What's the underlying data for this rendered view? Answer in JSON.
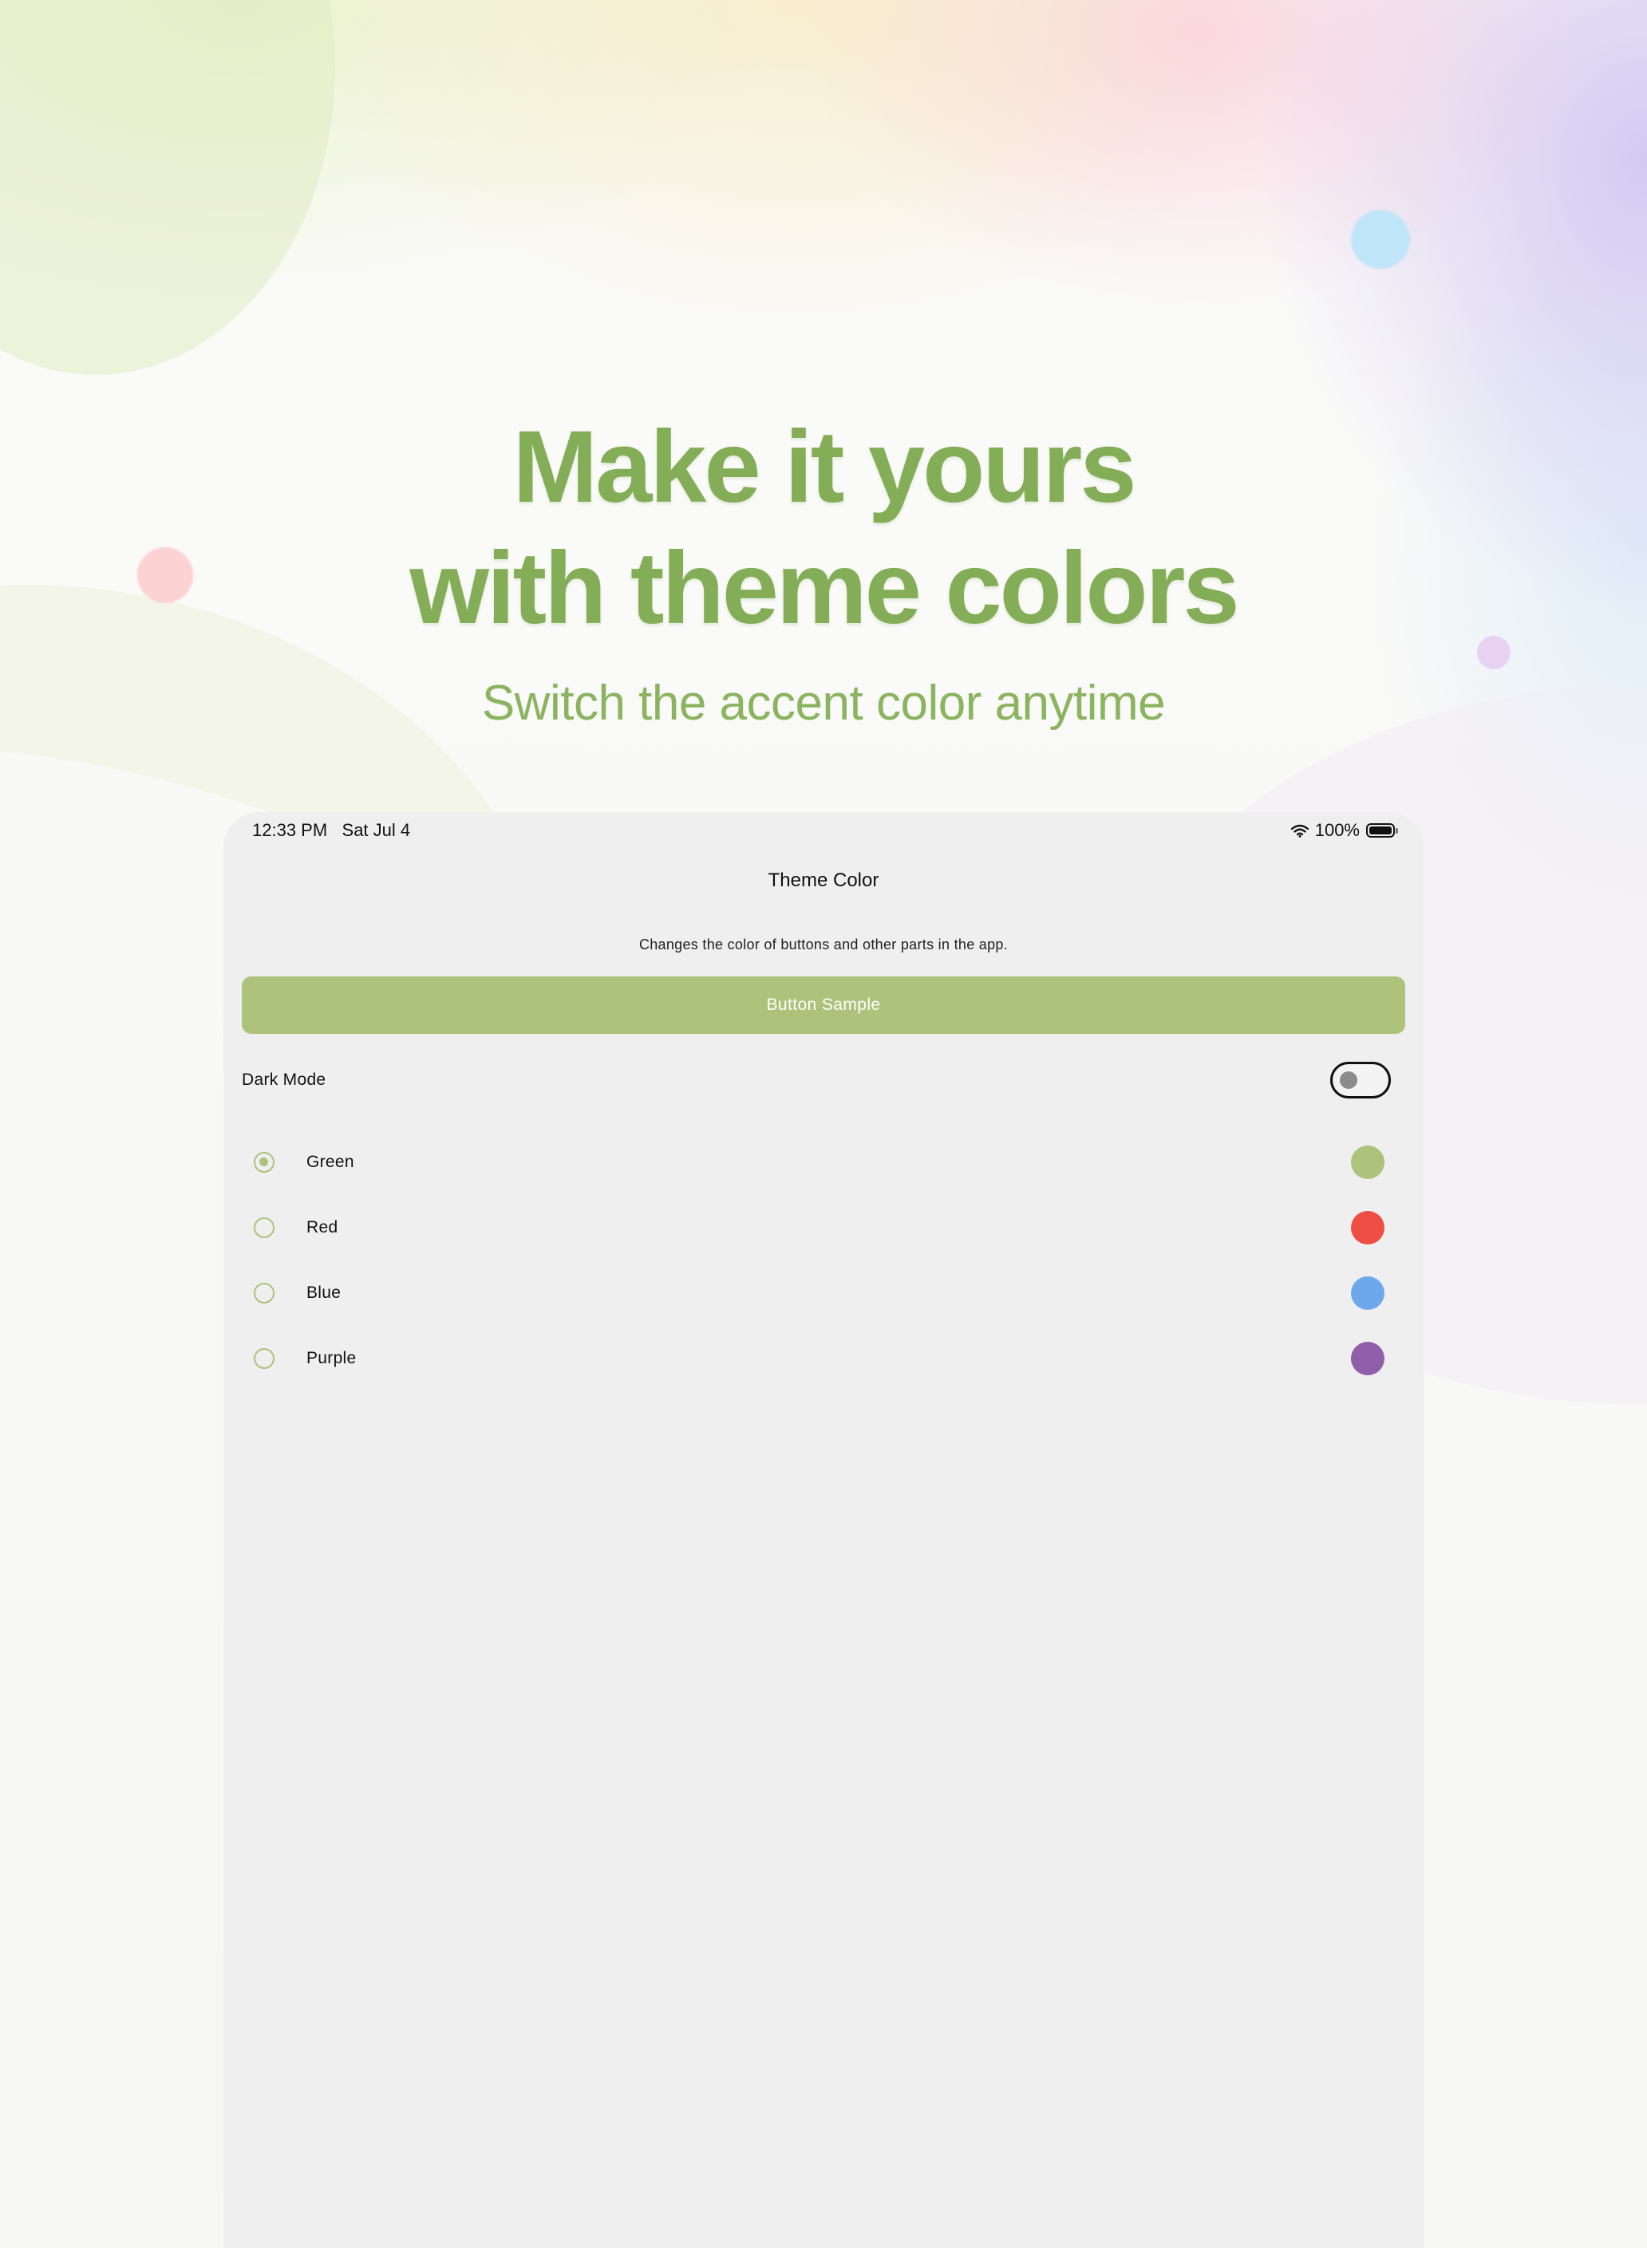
{
  "hero": {
    "headline_line1": "Make it yours",
    "headline_line2": "with theme colors",
    "subheadline": "Switch the accent color anytime",
    "accent_color": "#84ad57"
  },
  "status_bar": {
    "time": "12:33 PM",
    "date": "Sat Jul 4",
    "battery_text": "100%",
    "wifi_icon": "wifi-icon",
    "battery_icon": "battery-full-icon"
  },
  "screen": {
    "title": "Theme Color",
    "description": "Changes the color of buttons and other parts in the app.",
    "sample_button_label": "Button Sample",
    "dark_mode_label": "Dark Mode",
    "dark_mode_enabled": false,
    "selected_color": "Green",
    "colors": [
      {
        "label": "Green",
        "swatch": "#adc27a",
        "selected": true
      },
      {
        "label": "Red",
        "swatch": "#ee4e44",
        "selected": false
      },
      {
        "label": "Blue",
        "swatch": "#6ea8ec",
        "selected": false
      },
      {
        "label": "Purple",
        "swatch": "#915ea9",
        "selected": false
      }
    ]
  }
}
